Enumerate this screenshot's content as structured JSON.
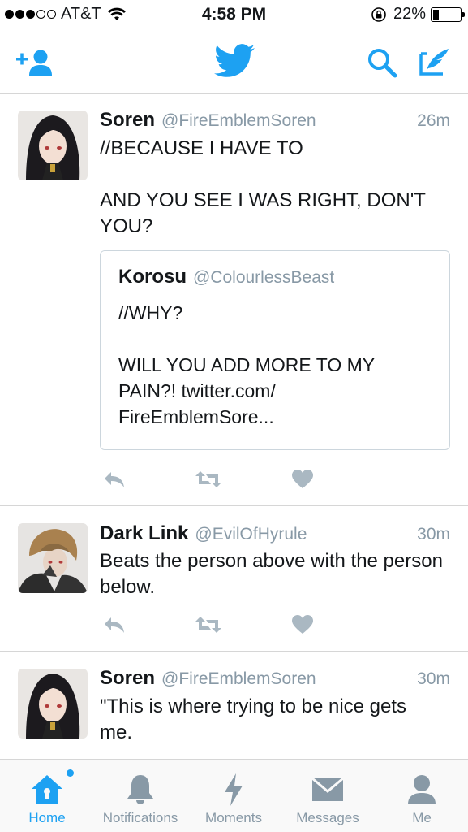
{
  "status_bar": {
    "carrier": "AT&T",
    "time": "4:58 PM",
    "battery": "22%",
    "battery_level": 0.22
  },
  "nav": {
    "left_icon": "add-user-icon",
    "center_icon": "twitter-bird-icon",
    "right_icons": [
      "search-icon",
      "compose-icon"
    ]
  },
  "tweets": [
    {
      "name": "Soren",
      "handle": "@FireEmblemSoren",
      "time": "26m",
      "text": "//BECAUSE I HAVE TO\n\nAND YOU SEE I WAS RIGHT, DON'T YOU?",
      "quote": {
        "name": "Korosu",
        "handle": "@ColourlessBeast",
        "text": "//WHY?\n\nWILL YOU ADD MORE TO MY PAIN?! twitter.com/\nFireEmblemSore..."
      }
    },
    {
      "name": "Dark Link",
      "handle": "@EvilOfHyrule",
      "time": "30m",
      "text": "Beats the person above with the person below."
    },
    {
      "name": "Soren",
      "handle": "@FireEmblemSoren",
      "time": "30m",
      "text": "\"This is where trying to be nice gets me."
    }
  ],
  "tabs": [
    {
      "label": "Home",
      "icon": "home-icon",
      "active": true
    },
    {
      "label": "Notifications",
      "icon": "bell-icon"
    },
    {
      "label": "Moments",
      "icon": "lightning-icon"
    },
    {
      "label": "Messages",
      "icon": "envelope-icon"
    },
    {
      "label": "Me",
      "icon": "person-icon"
    }
  ],
  "colors": {
    "accent": "#1da1f2",
    "muted": "#8899a6",
    "action_icon": "#aab8c2"
  }
}
